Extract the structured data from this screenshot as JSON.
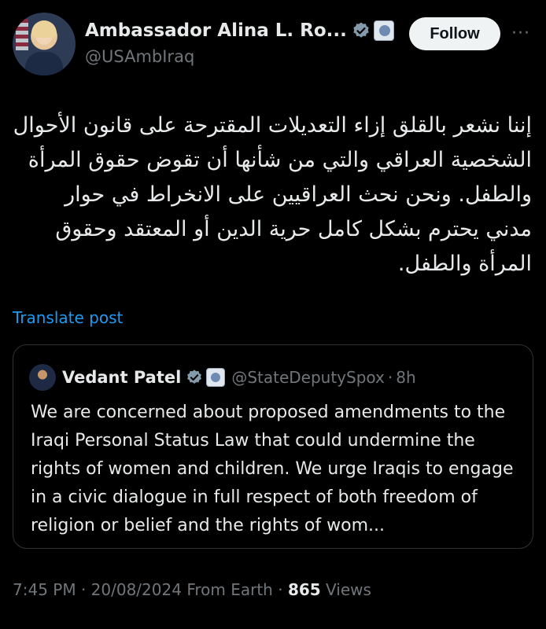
{
  "author": {
    "display_name": "Ambassador Alina L. Ro...",
    "handle": "@USAmbIraq"
  },
  "follow_label": "Follow",
  "more_label": "···",
  "tweet_text": "إننا نشعر بالقلق إزاء التعديلات المقترحة على قانون الأحوال الشخصية العراقي والتي من شأنها أن تقوض حقوق المرأة والطفل. ونحن نحث العراقيين على الانخراط في حوار مدني يحترم بشكل كامل حرية الدين أو المعتقد وحقوق المرأة والطفل.",
  "translate_label": "Translate post",
  "quote": {
    "display_name": "Vedant Patel",
    "handle": "@StateDeputySpox",
    "separator": "·",
    "time": "8h",
    "text": "We are concerned about proposed amendments to the Iraqi Personal Status Law that could undermine the rights of women and children. We urge Iraqis to engage in a civic dialogue in full respect of both freedom of religion or belief and the rights of wom..."
  },
  "meta": {
    "time": "7:45 PM",
    "sep1": "·",
    "date": "20/08/2024",
    "source": "From Earth",
    "sep2": "·",
    "views_count": "865",
    "views_label": "Views"
  },
  "colors": {
    "accent": "#1d9bf0",
    "verified": "#829aab",
    "text": "#e7e9ea",
    "muted": "#71767b"
  },
  "icons": {
    "verified": "verified-badge-icon",
    "affiliate": "state-department-seal-icon",
    "more": "more-options-icon"
  }
}
